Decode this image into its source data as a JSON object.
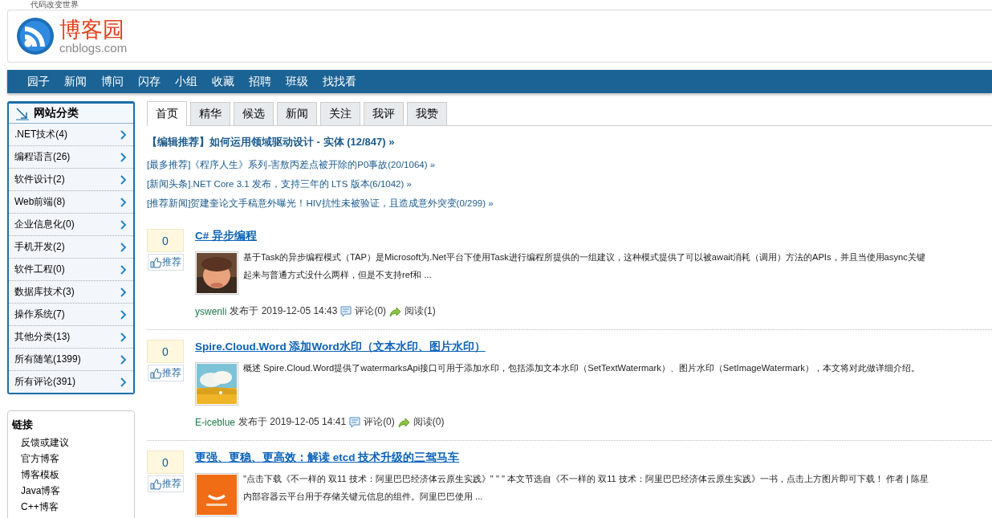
{
  "slogan": "代码改变世界",
  "site": {
    "name": "博客园",
    "domain": "cnblogs.com"
  },
  "nav": [
    "园子",
    "新闻",
    "博问",
    "闪存",
    "小组",
    "收藏",
    "招聘",
    "班级",
    "找找看"
  ],
  "sidebar": {
    "categories": {
      "title": "网站分类",
      "items": [
        ".NET技术(4)",
        "编程语言(26)",
        "软件设计(2)",
        "Web前端(8)",
        "企业信息化(0)",
        "手机开发(2)",
        "软件工程(0)",
        "数据库技术(3)",
        "操作系统(7)",
        "其他分类(13)",
        "所有随笔(1399)",
        "所有评论(391)"
      ]
    },
    "links": {
      "title": "链接",
      "items": [
        "反馈或建议",
        "官方博客",
        "博客模板",
        "Java博客",
        "C++博客"
      ]
    }
  },
  "tabs": [
    {
      "label": "首页",
      "selected": true
    },
    {
      "label": "精华",
      "selected": false
    },
    {
      "label": "候选",
      "selected": false
    },
    {
      "label": "新闻",
      "selected": false
    },
    {
      "label": "关注",
      "selected": false
    },
    {
      "label": "我评",
      "selected": false
    },
    {
      "label": "我赞",
      "selected": false
    }
  ],
  "headlines": [
    {
      "kind": "featured",
      "text": "【编辑推荐】如何运用领域驱动设计 - 实体 (12/847) »"
    },
    {
      "kind": "normal",
      "text": "[最多推荐]《程序人生》系列-害敖丙差点被开除的P0事故(20/1064) »"
    },
    {
      "kind": "normal",
      "text": "[新闻头条].NET Core 3.1 发布，支持三年的 LTS 版本(6/1042) »"
    },
    {
      "kind": "normal",
      "text": "[推荐新闻]贺建奎论文手稿意外曝光！HIV抗性未被验证，且造成意外突变(0/299) »"
    }
  ],
  "posts": [
    {
      "votes": "0",
      "vote_label": "推荐",
      "title": "C# 异步编程",
      "summary": "基于Task的异步编程模式（TAP）是Microsoft为.Net平台下使用Task进行编程所提供的一组建议，这种模式提供了可以被await消耗（调用）方法的APIs，并且当使用async关键",
      "summary_2": "起来与普通方式没什么两样，但是不支持ref和 ...",
      "author": "yswenli",
      "published": "发布于 2019-12-05 14:43",
      "comments": "评论(0)",
      "reads": "阅读(1)"
    },
    {
      "votes": "0",
      "vote_label": "推荐",
      "title": "Spire.Cloud.Word 添加Word水印（文本水印、图片水印）",
      "summary": "概述 Spire.Cloud.Word提供了watermarksApi接口可用于添加水印，包括添加文本水印（SetTextWatermark）、图片水印（SetImageWatermark），本文将对此做详细介绍。",
      "author": "E-iceblue",
      "published": "发布于 2019-12-05 14:41",
      "comments": "评论(0)",
      "reads": "阅读(0)"
    },
    {
      "votes": "0",
      "vote_label": "推荐",
      "title": "更强、更稳、更高效：解读 etcd 技术升级的三驾马车",
      "summary": "\"点击下载《不一样的 双11 技术：阿里巴巴经济体云原生实践》\" \" \" 本文节选自《不一样的 双11 技术：阿里巴巴经济体云原生实践》一书，点击上方图片即可下载！ 作者 | 陈星",
      "summary_2": "内部容器云平台用于存储关键元信息的组件。阿里巴巴使用 ..."
    }
  ]
}
